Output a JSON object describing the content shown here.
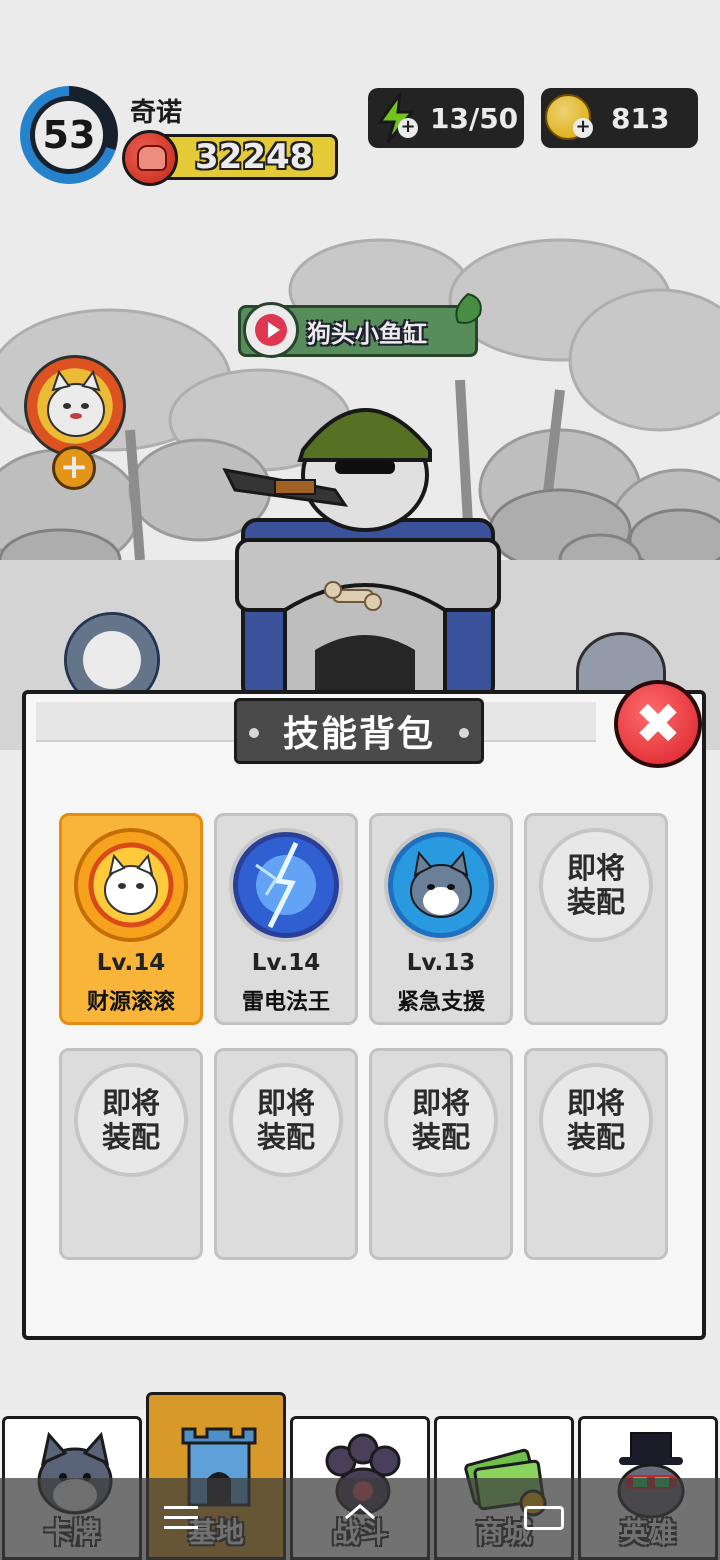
{
  "hud": {
    "level": "53",
    "player_name": "奇诺",
    "power": "32248",
    "energy": "13/50",
    "coins": "813"
  },
  "scene": {
    "video_banner": "狗头小鱼缸"
  },
  "dialog": {
    "title": "技能背包",
    "close_symbol": "✖",
    "slots": [
      {
        "level": "Lv.14",
        "name": "财源滚滚",
        "state": "selected",
        "icon": "lucky-cat-icon"
      },
      {
        "level": "Lv.14",
        "name": "雷电法王",
        "state": "owned",
        "icon": "lightning-orb-icon"
      },
      {
        "level": "Lv.13",
        "name": "紧急支援",
        "state": "owned",
        "icon": "husky-support-icon"
      },
      {
        "coming": "即将\n装配",
        "state": "locked"
      },
      {
        "coming": "即将\n装配",
        "state": "locked"
      },
      {
        "coming": "即将\n装配",
        "state": "locked"
      },
      {
        "coming": "即将\n装配",
        "state": "locked"
      },
      {
        "coming": "即将\n装配",
        "state": "locked"
      }
    ]
  },
  "nav": {
    "tabs": [
      {
        "label": "卡牌",
        "icon": "husky-card-icon"
      },
      {
        "label": "基地",
        "icon": "castle-icon",
        "active": true
      },
      {
        "label": "战斗",
        "icon": "paw-icon"
      },
      {
        "label": "商城",
        "icon": "cash-icon"
      },
      {
        "label": "英雄",
        "icon": "top-hat-hero-icon"
      }
    ]
  },
  "colors": {
    "accent_orange": "#f8b53a",
    "energy_green": "#7ed321",
    "coin_yellow": "#f0b400",
    "close_red": "#d8202a",
    "banner_green": "#5f9a63"
  }
}
